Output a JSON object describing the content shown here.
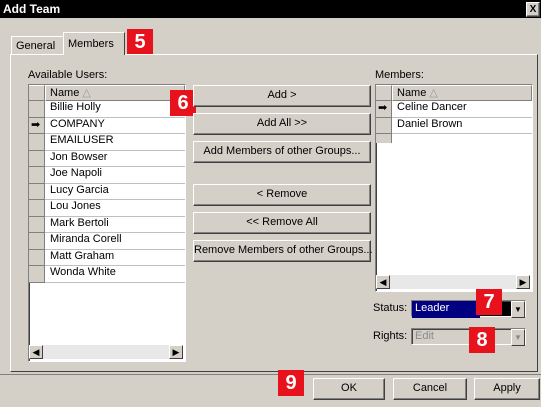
{
  "window": {
    "title": "Add Team",
    "close_glyph": "X"
  },
  "tabs": [
    {
      "label": "General",
      "active": false
    },
    {
      "label": "Members",
      "active": true
    }
  ],
  "available": {
    "label": "Available Users:",
    "column": "Name",
    "sort_icon": "sort-asc-icon",
    "users": [
      "Billie Holly",
      "COMPANY",
      "EMAILUSER",
      "Jon Bowser",
      "Joe Napoli",
      "Lucy Garcia",
      "Lou Jones",
      "Mark Bertoli",
      "Miranda Corell",
      "Matt Graham",
      "Wonda White"
    ],
    "current_row": "COMPANY"
  },
  "members": {
    "label": "Members:",
    "column": "Name",
    "sort_icon": "sort-asc-icon",
    "users": [
      "Celine Dancer",
      "Daniel Brown"
    ],
    "current_row": "Celine Dancer"
  },
  "actions": {
    "add": "Add >",
    "add_all": "Add All >>",
    "add_groups": "Add Members of other Groups...",
    "remove": "< Remove",
    "remove_all": "<< Remove All",
    "remove_groups": "Remove Members of other Groups..."
  },
  "status": {
    "label": "Status:",
    "value": "Leader"
  },
  "rights": {
    "label": "Rights:",
    "value": "Edit",
    "disabled": true
  },
  "footer": {
    "ok": "OK",
    "cancel": "Cancel",
    "apply": "Apply"
  },
  "callouts": [
    "5",
    "6",
    "7",
    "8",
    "9"
  ],
  "colors": {
    "callout": "#e8121d",
    "dialog": "#d4d0c8",
    "title_bar": "#000000",
    "status_selected": "#000080"
  }
}
